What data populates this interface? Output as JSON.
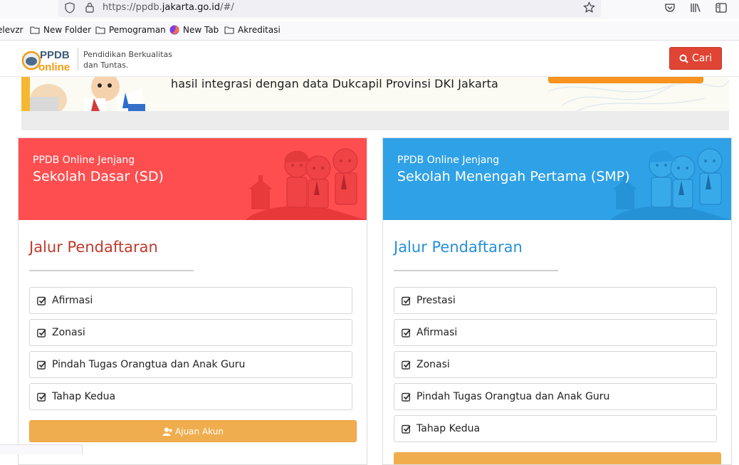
{
  "browser": {
    "url_prefix": "https://ppdb.",
    "url_domain": "jakarta.go.id",
    "url_suffix": "/#/",
    "bookmarks": [
      "elevzr",
      "New Folder",
      "Pemograman",
      "New Tab",
      "Akreditasi"
    ]
  },
  "header": {
    "logo_top": "PPDB",
    "logo_bottom": "online",
    "tagline_line1": "Pendidikan Berkualitas",
    "tagline_line2": "dan Tuntas.",
    "search_label": "Cari",
    "accent": "#e04434"
  },
  "banner": {
    "text": "hasil integrasi dengan data Dukcapil Provinsi DKI Jakarta"
  },
  "cards": {
    "sd": {
      "subtitle": "PPDB Online Jenjang",
      "title": "Sekolah Dasar (SD)",
      "color": "#ff4e50",
      "section_title": "Jalur Pendaftaran",
      "items": [
        "Afirmasi",
        "Zonasi",
        "Pindah Tugas Orangtua dan Anak Guru",
        "Tahap Kedua"
      ],
      "button_label": "Ajuan Akun"
    },
    "smp": {
      "subtitle": "PPDB Online Jenjang",
      "title": "Sekolah Menengah Pertama (SMP)",
      "color": "#2fa1e6",
      "section_title": "Jalur Pendaftaran",
      "items": [
        "Prestasi",
        "Afirmasi",
        "Zonasi",
        "Pindah Tugas Orangtua dan Anak Guru",
        "Tahap Kedua"
      ]
    }
  }
}
